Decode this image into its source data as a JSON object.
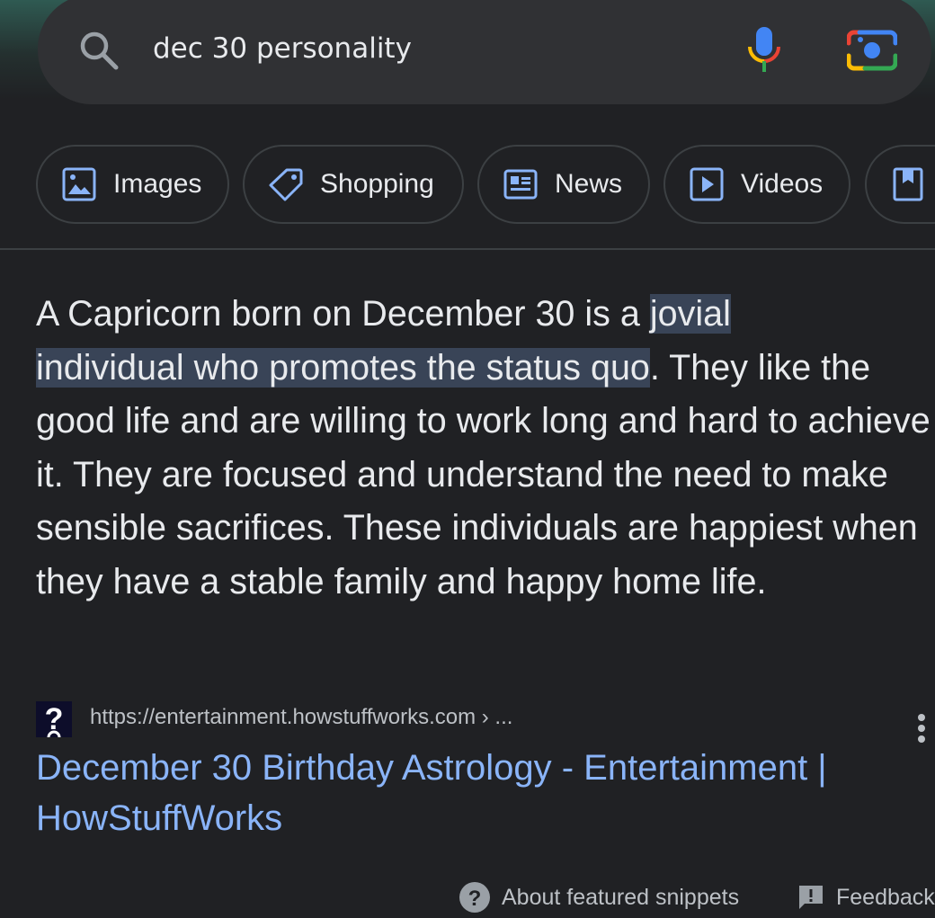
{
  "search": {
    "query": "dec 30 personality",
    "icons": {
      "search": "search-icon",
      "mic": "microphone-icon",
      "lens": "google-lens-icon"
    }
  },
  "filters": [
    {
      "label": "Images",
      "icon": "image-icon"
    },
    {
      "label": "Shopping",
      "icon": "tag-icon"
    },
    {
      "label": "News",
      "icon": "newspaper-icon"
    },
    {
      "label": "Videos",
      "icon": "play-icon"
    },
    {
      "label": "",
      "icon": "book-icon"
    }
  ],
  "snippet": {
    "before": "A Capricorn born on December 30 is a ",
    "highlighted_line1": "jovial",
    "highlighted_line2": "individual who promotes the status quo",
    "after": ". They like the good life and are willing to work long and hard to achieve it. They are focused and understand the need to make sensible sacrifices. These individuals are happiest when they have a stable family and happy home life."
  },
  "source": {
    "favicon_text": "?",
    "url": "https://entertainment.howstuffworks.com › ...",
    "title": "December 30 Birthday Astrology - Entertainment | HowStuffWorks"
  },
  "footer": {
    "about": "About featured snippets",
    "feedback": "Feedback"
  },
  "colors": {
    "background": "#202124",
    "search_bar": "#303134",
    "link": "#8ab4f8",
    "highlight": "#394457",
    "chip_icon": "#8ab4f8"
  }
}
